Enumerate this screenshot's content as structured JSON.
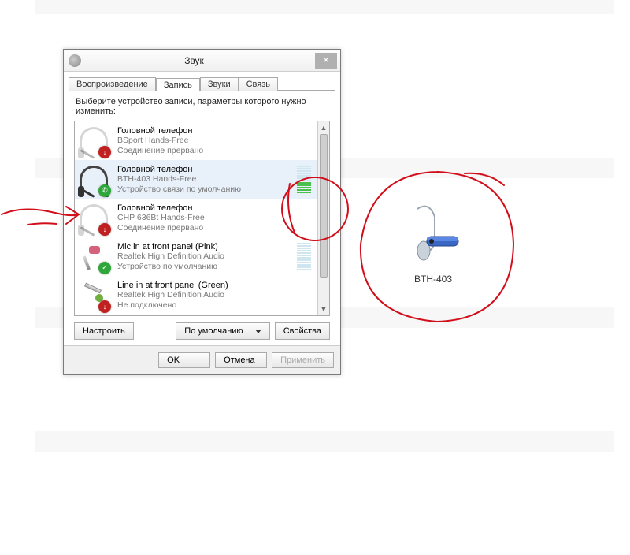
{
  "dialog": {
    "title": "Звук",
    "tabs": [
      "Воспроизведение",
      "Запись",
      "Звуки",
      "Связь"
    ],
    "active_tab_index": 1,
    "instruction": "Выберите устройство записи, параметры которого нужно изменить:",
    "devices": [
      {
        "name": "Головной телефон",
        "sub": "BSport Hands-Free",
        "status": "Соединение прервано",
        "icon": "headset-faded",
        "badge": "disconnected",
        "selected": false,
        "meter": null
      },
      {
        "name": "Головной телефон",
        "sub": "BTH-403 Hands-Free",
        "status": "Устройство связи по умолчанию",
        "icon": "headset",
        "badge": "phone",
        "selected": true,
        "meter": {
          "total": 12,
          "on": 5
        }
      },
      {
        "name": "Головной телефон",
        "sub": "CHP 636Bt Hands-Free",
        "status": "Соединение прервано",
        "icon": "headset-faded",
        "badge": "disconnected",
        "selected": false,
        "meter": null
      },
      {
        "name": "Mic in at front panel (Pink)",
        "sub": "Realtek High Definition Audio",
        "status": "Устройство по умолчанию",
        "icon": "mic-pink",
        "badge": "ok",
        "selected": false,
        "meter": {
          "total": 12,
          "on": 0
        }
      },
      {
        "name": "Line in at front panel (Green)",
        "sub": "Realtek High Definition Audio",
        "status": "Не подключено",
        "icon": "linein",
        "badge": "disconnected",
        "selected": false,
        "meter": null
      }
    ],
    "buttons": {
      "configure": "Настроить",
      "set_default": "По умолчанию",
      "properties": "Свойства",
      "ok": "OK",
      "cancel": "Отмена",
      "apply": "Применить"
    }
  },
  "external": {
    "device_label": "BTH-403"
  }
}
